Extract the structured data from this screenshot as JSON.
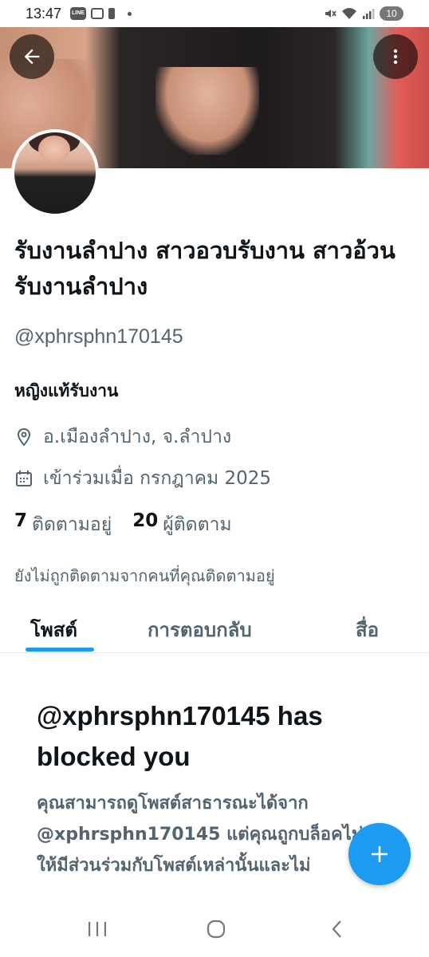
{
  "status_bar": {
    "time": "13:47",
    "line_badge": "LINE",
    "battery": "10"
  },
  "profile": {
    "display_name": "รับงานลำปาง สาวอวบรับงาน สาวอ้วนรับงานลำปาง",
    "handle": "@xphrsphn170145",
    "bio": "หญิงแท้รับงาน",
    "location": "อ.เมืองลำปาง, จ.ลำปาง",
    "joined": "เข้าร่วมเมื่อ กรกฎาคม 2025",
    "following_count": "7",
    "following_label": "ติดตามอยู่",
    "followers_count": "20",
    "followers_label": "ผู้ติดตาม",
    "not_followed_note": "ยังไม่ถูกติดตามจากคนที่คุณติดตามอยู่"
  },
  "tabs": [
    {
      "label": "โพสต์",
      "active": true
    },
    {
      "label": "การตอบกลับ",
      "active": false
    },
    {
      "label": "สื่อ",
      "active": false
    }
  ],
  "blocked": {
    "title": "@xphrsphn170145 has blocked you",
    "body": "คุณสามารถดูโพสต์สาธารณะได้จาก @xphrsphn170145 แต่คุณถูกบล็อคไม่ให้มีส่วนร่วมกับโพสต์เหล่านั้นและไม่"
  },
  "colors": {
    "accent": "#1d9bf0",
    "primary_text": "#0f1419",
    "secondary_text": "#536471"
  },
  "icons": {
    "back": "arrow-left-icon",
    "more": "more-vertical-icon",
    "location": "location-pin-icon",
    "calendar": "calendar-icon",
    "compose": "plus-icon"
  }
}
